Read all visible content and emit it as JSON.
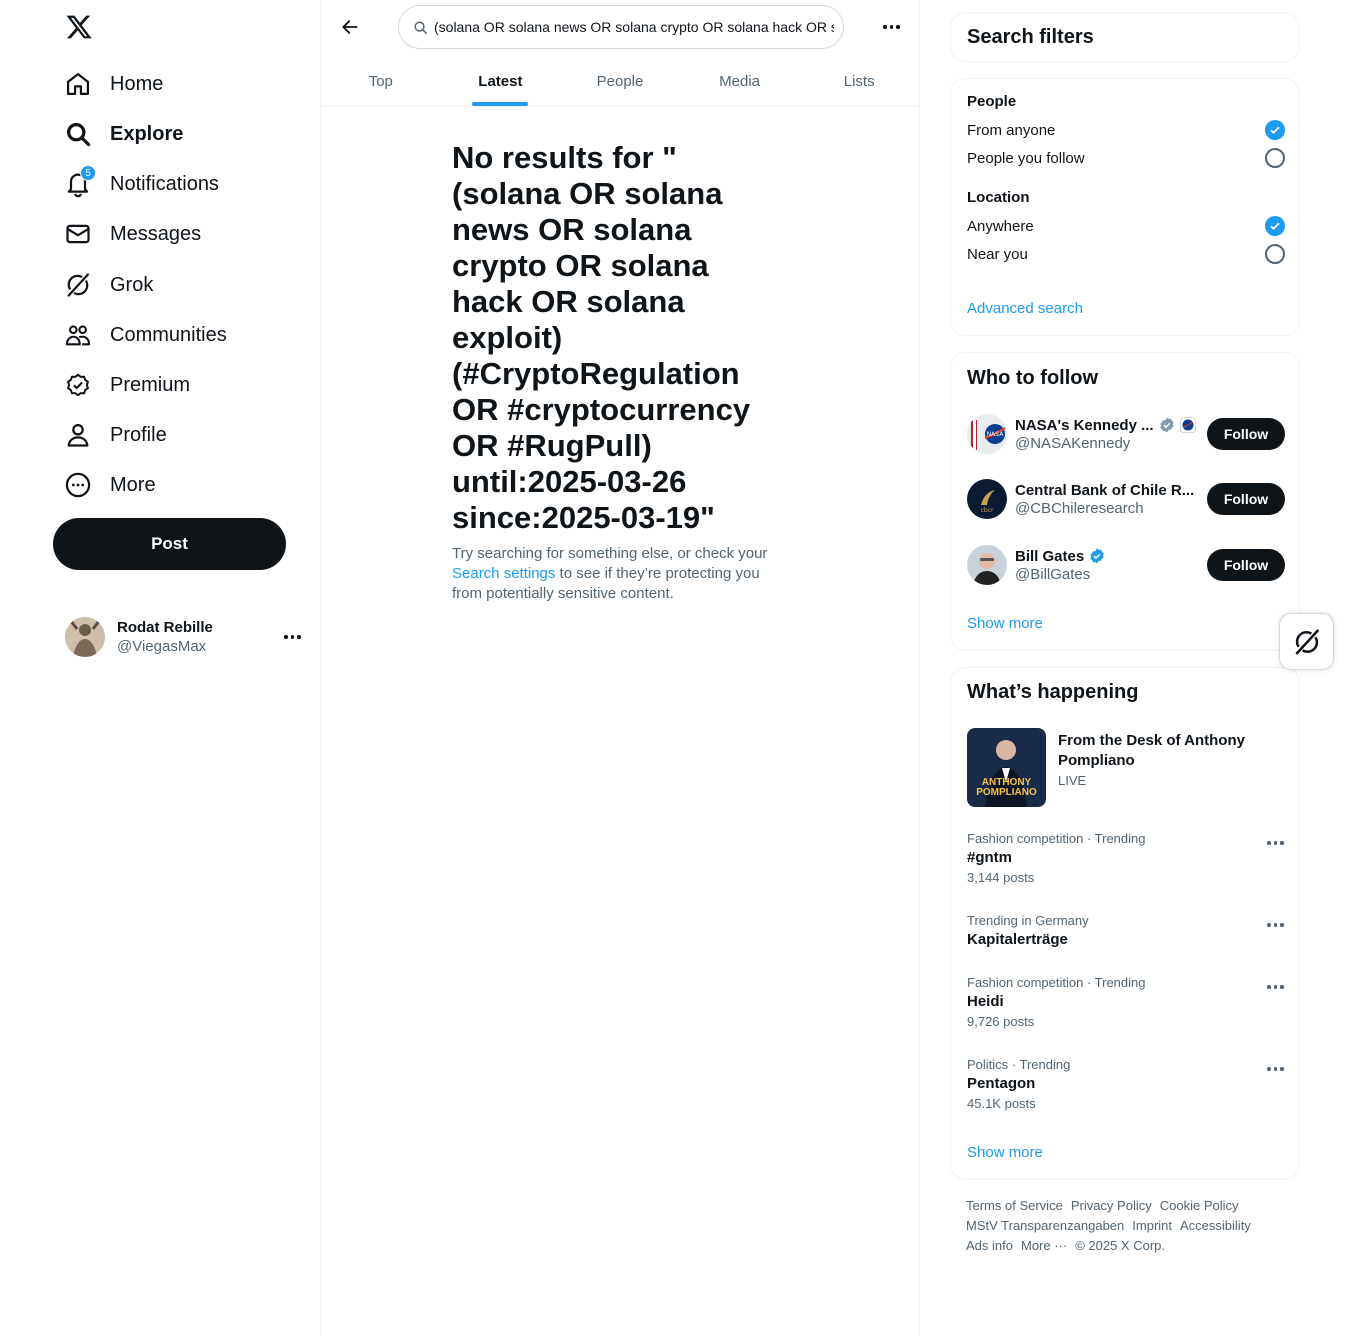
{
  "nav": {
    "items": [
      {
        "label": "Home",
        "icon": "home-icon"
      },
      {
        "label": "Explore",
        "icon": "search-icon"
      },
      {
        "label": "Notifications",
        "icon": "bell-icon",
        "badge": "5"
      },
      {
        "label": "Messages",
        "icon": "envelope-icon"
      },
      {
        "label": "Grok",
        "icon": "grok-icon"
      },
      {
        "label": "Communities",
        "icon": "communities-icon"
      },
      {
        "label": "Premium",
        "icon": "premium-icon"
      },
      {
        "label": "Profile",
        "icon": "person-icon"
      },
      {
        "label": "More",
        "icon": "more-circle-icon"
      }
    ],
    "active": "Explore",
    "post_label": "Post"
  },
  "account": {
    "name": "Rodat Rebille",
    "handle": "@ViegasMax"
  },
  "search": {
    "query": "(solana OR solana news OR solana crypto OR solana hack OR solana exploit) (#CryptoRegulation OR #cryptocurrency OR #RugPull) until:2025-03-26 since:2025-03-19"
  },
  "tabs": [
    "Top",
    "Latest",
    "People",
    "Media",
    "Lists"
  ],
  "active_tab": "Latest",
  "empty": {
    "title": "No results for \"(solana OR solana news OR solana crypto OR solana hack OR solana exploit) (#CryptoRegulation OR #cryptocurrency OR #RugPull) until:2025-03-26 since:2025-03-19\"",
    "sub_before": "Try searching for something else, or check your ",
    "sub_link": "Search settings",
    "sub_after": " to see if they’re protecting you from potentially sensitive content."
  },
  "filters": {
    "title": "Search filters",
    "people_label": "People",
    "people_options": [
      {
        "label": "From anyone",
        "checked": true
      },
      {
        "label": "People you follow",
        "checked": false
      }
    ],
    "location_label": "Location",
    "location_options": [
      {
        "label": "Anywhere",
        "checked": true
      },
      {
        "label": "Near you",
        "checked": false
      }
    ],
    "advanced_link": "Advanced search"
  },
  "who_to_follow": {
    "title": "Who to follow",
    "accounts": [
      {
        "name": "NASA's Kennedy ...",
        "handle": "@NASAKennedy",
        "verified": "gray",
        "button": "Follow"
      },
      {
        "name": "Central Bank of Chile R...",
        "handle": "@CBChileresearch",
        "verified": "none",
        "button": "Follow"
      },
      {
        "name": "Bill Gates",
        "handle": "@BillGates",
        "verified": "blue",
        "button": "Follow"
      }
    ],
    "show_more": "Show more"
  },
  "happening": {
    "title": "What’s happening",
    "featured": {
      "title": "From the Desk of Anthony Pompliano",
      "status": "LIVE",
      "thumb_text": "ANTHONY POMPLIANO"
    },
    "trends": [
      {
        "meta": "Fashion competition · Trending",
        "title": "#gntm",
        "count": "3,144 posts"
      },
      {
        "meta": "Trending in Germany",
        "title": "Kapitalerträge",
        "count": ""
      },
      {
        "meta": "Fashion competition · Trending",
        "title": "Heidi",
        "count": "9,726 posts"
      },
      {
        "meta": "Politics · Trending",
        "title": "Pentagon",
        "count": "45.1K posts"
      }
    ],
    "show_more": "Show more"
  },
  "footer": {
    "links": [
      "Terms of Service",
      "Privacy Policy",
      "Cookie Policy",
      "MStV Transparenzangaben",
      "Imprint",
      "Accessibility",
      "Ads info",
      "More ···",
      "© 2025 X Corp."
    ]
  },
  "colors": {
    "accent": "#1d9bf0",
    "text": "#0f1419",
    "secondary": "#536471",
    "border": "#eff3f4"
  }
}
